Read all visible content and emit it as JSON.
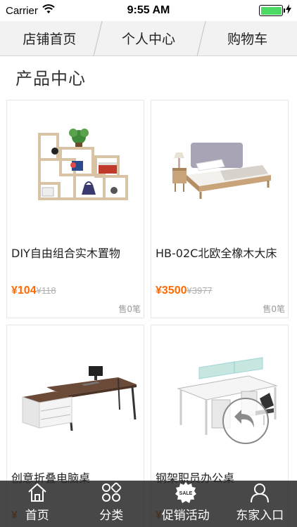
{
  "status_bar": {
    "carrier": "Carrier",
    "time": "9:55 AM",
    "battery_color": "#4cd964"
  },
  "top_nav": {
    "tabs": [
      {
        "label": "店铺首页"
      },
      {
        "label": "个人中心"
      },
      {
        "label": "购物车"
      }
    ]
  },
  "section": {
    "title": "产品中心"
  },
  "products": [
    {
      "name": "DIY自由组合实木置物",
      "price": "¥104",
      "old_price": "¥118",
      "sold": "售0笔"
    },
    {
      "name": "HB-02C北欧全橡木大床",
      "price": "¥3500",
      "old_price": "¥3977",
      "sold": "售0笔"
    },
    {
      "name": "创意折叠电脑桌",
      "price": "¥",
      "old_price": "",
      "sold": ""
    },
    {
      "name": "钢架职员办公桌",
      "price": "¥",
      "old_price": "",
      "sold": ""
    }
  ],
  "bottom_bar": {
    "tabs": [
      {
        "label": "首页",
        "icon": "home-icon"
      },
      {
        "label": "分类",
        "icon": "category-icon"
      },
      {
        "label": "促销活动",
        "icon": "sale-icon",
        "badge": "SALE"
      },
      {
        "label": "东家入口",
        "icon": "user-icon"
      }
    ]
  },
  "colors": {
    "price": "#ff6a00",
    "bottom_bar": "#282828"
  }
}
